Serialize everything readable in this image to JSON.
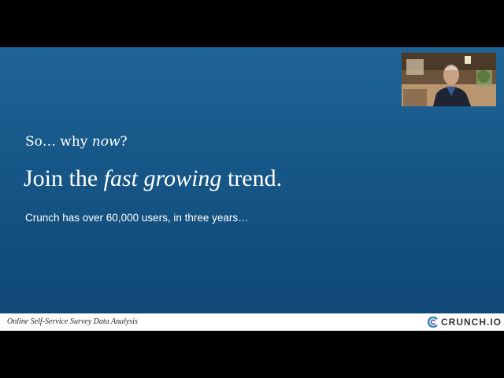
{
  "slide": {
    "kicker": {
      "before": "So… why ",
      "emphasis": "now",
      "after": "?"
    },
    "headline": {
      "before": "Join the ",
      "emphasis": "fast growing",
      "after": " trend."
    },
    "body": "Crunch has over 60,000 users, in three years…"
  },
  "footer": {
    "caption": "Online Self-Service Survey Data Analysis",
    "logo_text": "CRUNCH.IO",
    "logo_icon": "crunch-c-logo"
  },
  "webcam": {
    "description_icon": "presenter-video-feed"
  },
  "colors": {
    "slide_background": "#175888",
    "letterbox": "#000000",
    "footer_background": "#ffffff",
    "logo_accent": "#2b8ab8"
  }
}
